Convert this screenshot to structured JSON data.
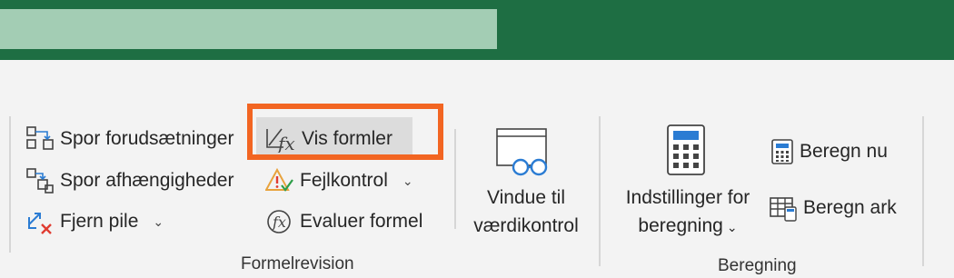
{
  "ribbon": {
    "formula_auditing": {
      "trace_precedents": "Spor forudsætninger",
      "trace_dependents": "Spor afhængigheder",
      "remove_arrows": "Fjern pile",
      "show_formulas": "Vis formler",
      "error_checking": "Fejlkontrol",
      "evaluate_formula": "Evaluer formel",
      "watch_window_line1": "Vindue til",
      "watch_window_line2": "værdikontrol",
      "group_label": "Formelrevision"
    },
    "calculation": {
      "options_line1": "Indstillinger for",
      "options_line2": "beregning",
      "calc_now": "Beregn nu",
      "calc_sheet": "Beregn ark",
      "group_label": "Beregning"
    }
  },
  "icons": {
    "trace_precedents": "trace-precedents-icon",
    "trace_dependents": "trace-dependents-icon",
    "remove_arrows": "remove-arrows-icon",
    "show_formulas": "show-formulas-icon",
    "error_checking": "error-checking-icon",
    "evaluate_formula": "evaluate-formula-icon",
    "watch_window": "watch-window-icon",
    "calculation_options": "calculator-icon",
    "calc_now": "calculator-small-icon",
    "calc_sheet": "calc-sheet-icon"
  },
  "colors": {
    "title_bar": "#1e6e43",
    "search_bar": "#a3cdb4",
    "highlight": "#f26522",
    "accent_blue": "#2b7cd3"
  }
}
